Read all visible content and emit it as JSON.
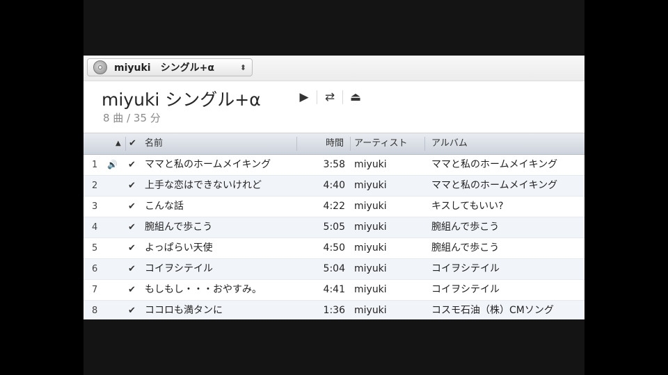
{
  "source_popup": {
    "icon": "cd-icon",
    "label": "miyuki　シングル+α",
    "arrows": "⬍"
  },
  "playlist": {
    "title": "miyuki シングル+α",
    "summary": "8 曲 / 35 分"
  },
  "controls": {
    "play": "▶",
    "shuffle": "⇄",
    "eject": "⏏"
  },
  "columns": {
    "sort_indicator": "▲",
    "check": "✔",
    "name": "名前",
    "time": "時間",
    "artist": "アーティスト",
    "album": "アルバム"
  },
  "tracks": [
    {
      "num": "1",
      "playing": "🔊",
      "check": "✔",
      "name": "ママと私のホームメイキング",
      "time": "3:58",
      "artist": "miyuki",
      "album": "ママと私のホームメイキング"
    },
    {
      "num": "2",
      "playing": "",
      "check": "✔",
      "name": "上手な恋はできないけれど",
      "time": "4:40",
      "artist": "miyuki",
      "album": "ママと私のホームメイキング"
    },
    {
      "num": "3",
      "playing": "",
      "check": "✔",
      "name": "こんな話",
      "time": "4:22",
      "artist": "miyuki",
      "album": "キスしてもいい?"
    },
    {
      "num": "4",
      "playing": "",
      "check": "✔",
      "name": "腕組んで歩こう",
      "time": "5:05",
      "artist": "miyuki",
      "album": "腕組んで歩こう"
    },
    {
      "num": "5",
      "playing": "",
      "check": "✔",
      "name": "よっぱらい天使",
      "time": "4:50",
      "artist": "miyuki",
      "album": "腕組んで歩こう"
    },
    {
      "num": "6",
      "playing": "",
      "check": "✔",
      "name": "コイヲシテイル",
      "time": "5:04",
      "artist": "miyuki",
      "album": "コイヲシテイル"
    },
    {
      "num": "7",
      "playing": "",
      "check": "✔",
      "name": "もしもし・・・おやすみ。",
      "time": "4:41",
      "artist": "miyuki",
      "album": "コイヲシテイル"
    },
    {
      "num": "8",
      "playing": "",
      "check": "✔",
      "name": "ココロも満タンに",
      "time": "1:36",
      "artist": "miyuki",
      "album": "コスモ石油（株）CMソング"
    }
  ]
}
